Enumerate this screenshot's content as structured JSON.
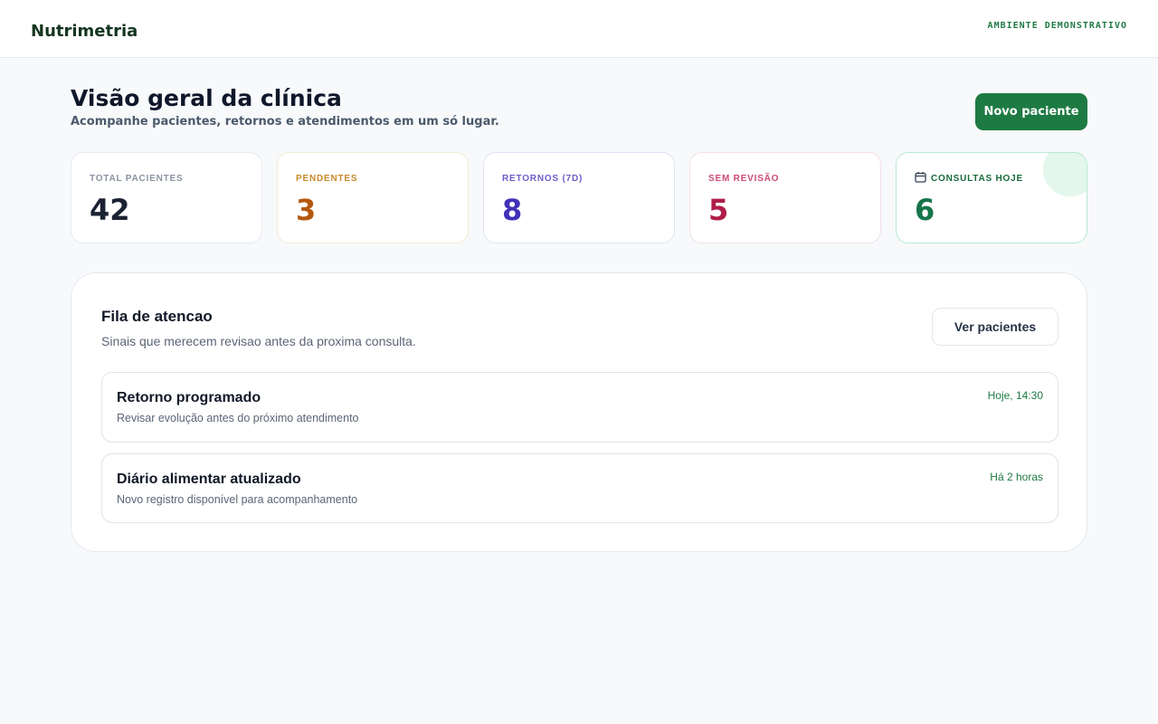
{
  "header": {
    "brand": "Nutrimetria",
    "environment": "AMBIENTE DEMONSTRATIVO"
  },
  "page": {
    "title": "Visão geral da clínica",
    "subtitle": "Acompanhe pacientes, retornos e atendimentos em um só lugar.",
    "primary_button": "Novo paciente"
  },
  "stats": [
    {
      "label": "TOTAL PACIENTES",
      "value": "42",
      "color": "#1a2233"
    },
    {
      "label": "PENDENTES",
      "value": "3",
      "color": "#b4580f"
    },
    {
      "label": "RETORNOS (7D)",
      "value": "8",
      "color": "#4131b8"
    },
    {
      "label": "SEM REVISÃO",
      "value": "5",
      "color": "#b01d48"
    },
    {
      "label": "CONSULTAS HOJE",
      "value": "6",
      "color": "#16754a",
      "icon": "calendar-icon"
    }
  ],
  "queue": {
    "title": "Fila de atencao",
    "subtitle": "Sinais que merecem revisao antes da proxima consulta.",
    "button": "Ver pacientes",
    "items": [
      {
        "title": "Retorno programado",
        "description": "Revisar evolução antes do próximo atendimento",
        "time": "Hoje, 14:30"
      },
      {
        "title": "Diário alimentar atualizado",
        "description": "Novo registro disponível para acompanhamento",
        "time": "Há 2 horas"
      }
    ]
  },
  "colors": {
    "accent": "#1e7a43",
    "background": "#f7f9fb"
  }
}
